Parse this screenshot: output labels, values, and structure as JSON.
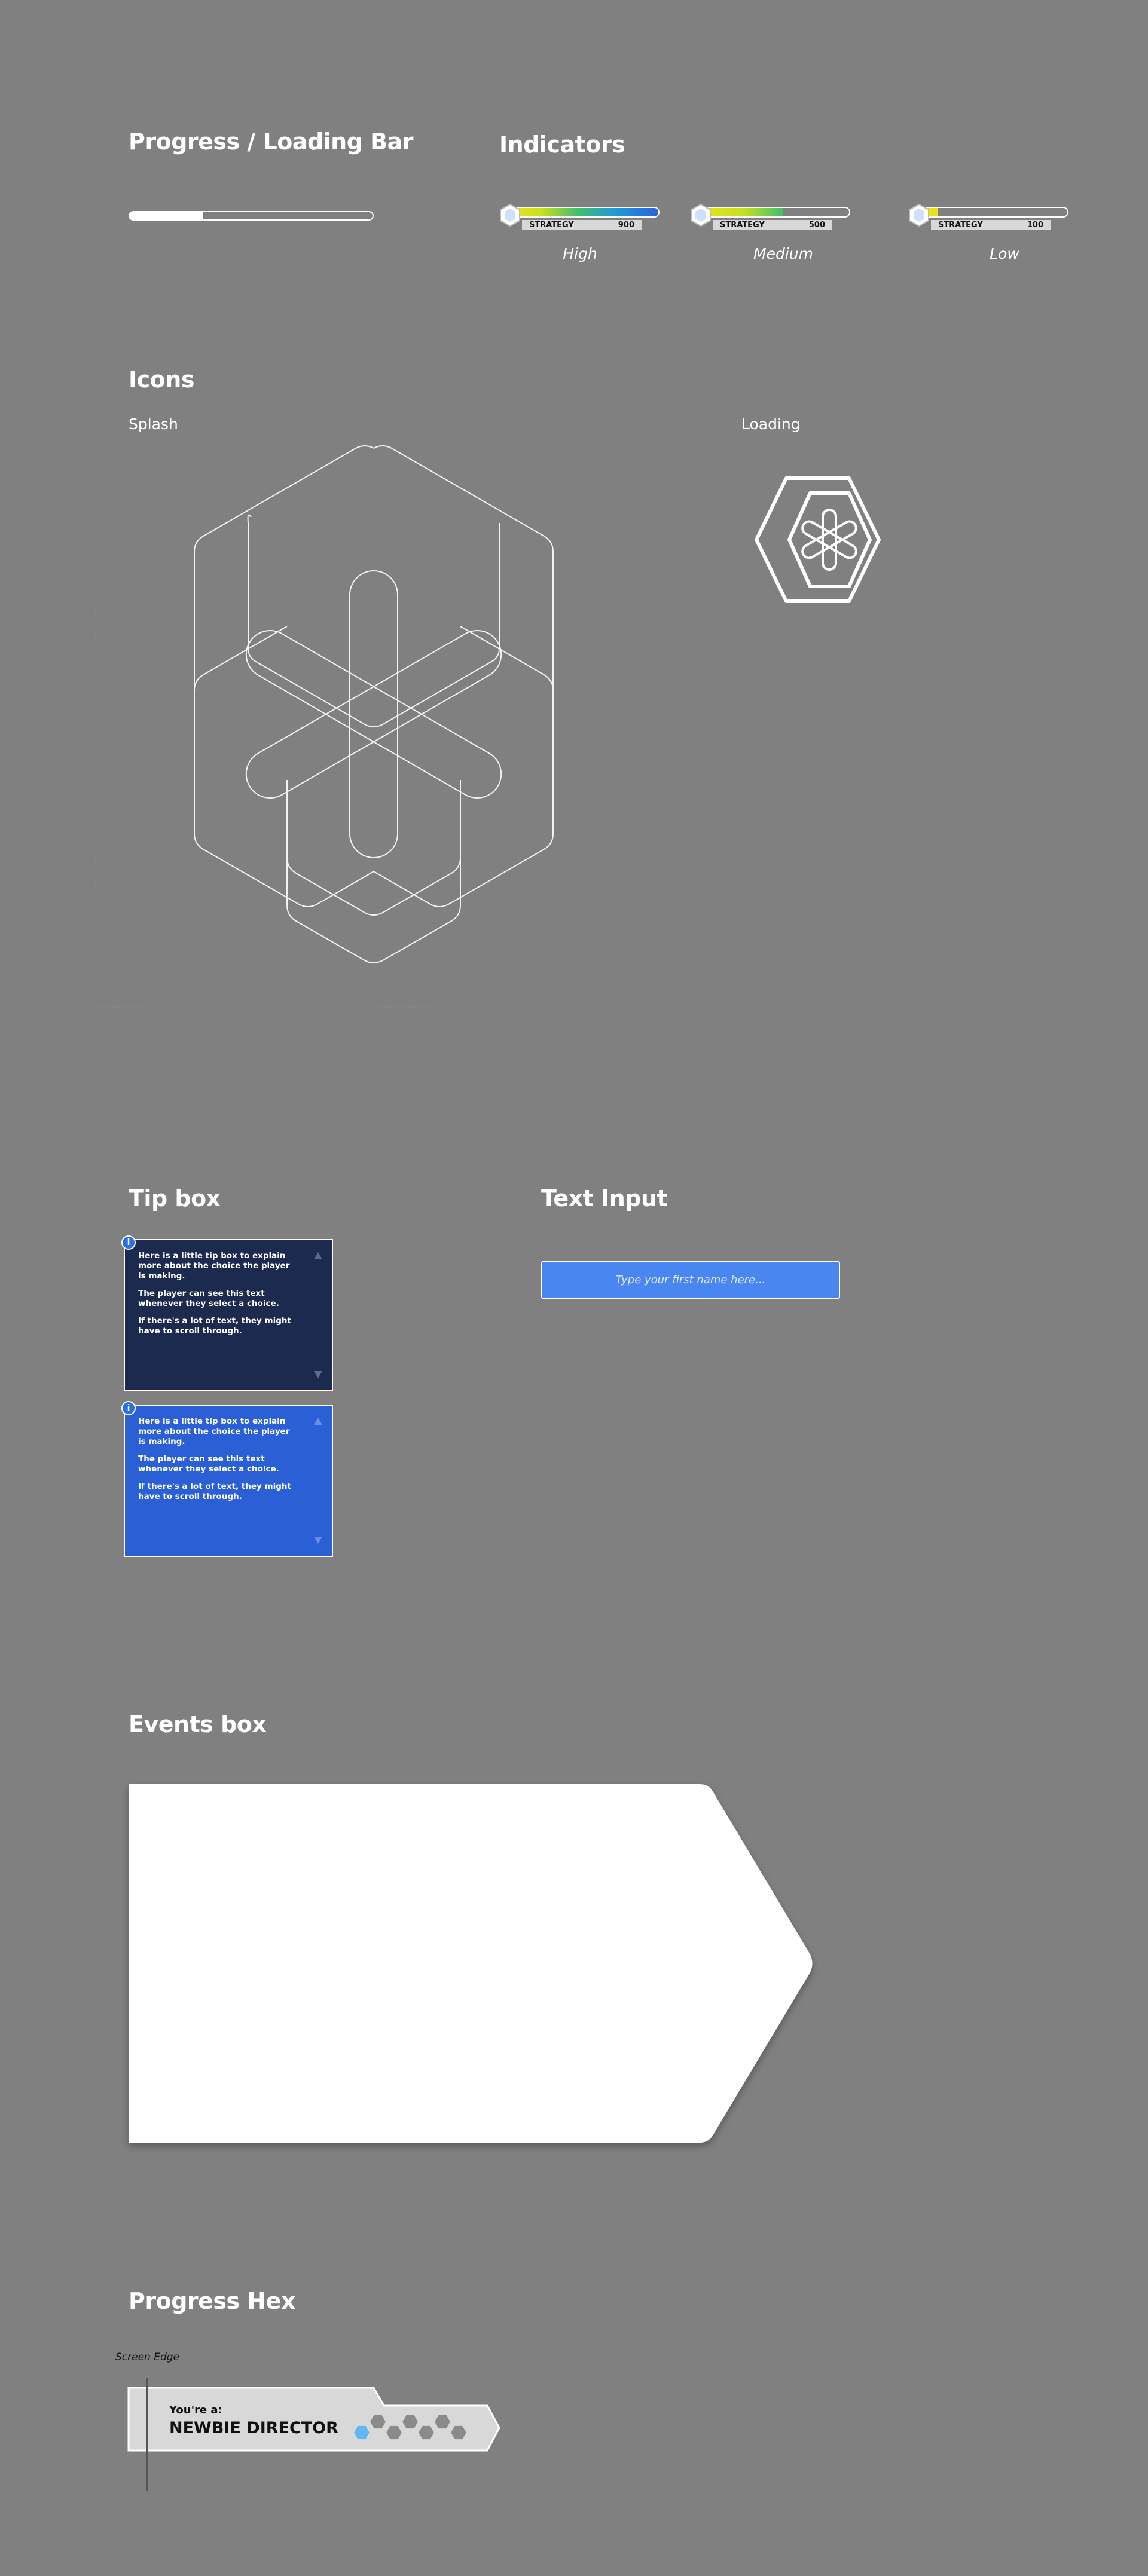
{
  "progress_bar": {
    "title": "Progress / Loading Bar",
    "level": 0.3
  },
  "indicators": {
    "title": "Indicators",
    "items": [
      {
        "label": "STRATEGY",
        "value": "900",
        "caption": "High",
        "level": 1.0,
        "gradient": "linear-gradient(90deg,#e9e21a 0%,#c8e020 20%,#3fbf6a 45%,#1f9bd6 70%,#2a63e0 100%)"
      },
      {
        "label": "STRATEGY",
        "value": "500",
        "caption": "Medium",
        "level": 0.55,
        "gradient": "linear-gradient(90deg,#e9e21a 0%,#c8e020 50%,#3fbf6a 100%)"
      },
      {
        "label": "STRATEGY",
        "value": "100",
        "caption": "Low",
        "level": 0.11,
        "gradient": "linear-gradient(90deg,#e9e21a 0%,#e9e21a 100%)"
      }
    ]
  },
  "icons": {
    "title": "Icons",
    "splash_label": "Splash",
    "loading_label": "Loading"
  },
  "tip_box": {
    "title": "Tip box",
    "paragraphs": [
      "Here is a little tip box to explain more about the choice the player is making.",
      "The player can see this text whenever they select a choice.",
      "If there's a lot of text, they might have to scroll through."
    ],
    "info_glyph": "i",
    "dark_color": "#1b2a4e",
    "blue_color": "#2a5fd6"
  },
  "text_input": {
    "title": "Text Input",
    "placeholder": "Type your first name here..."
  },
  "events_box": {
    "title": "Events box"
  },
  "progress_hex": {
    "title": "Progress Hex",
    "screen_edge_label": "Screen Edge",
    "line1": "You're a:",
    "line2": "NEWBIE DIRECTOR",
    "filled": 1,
    "total": 7
  }
}
